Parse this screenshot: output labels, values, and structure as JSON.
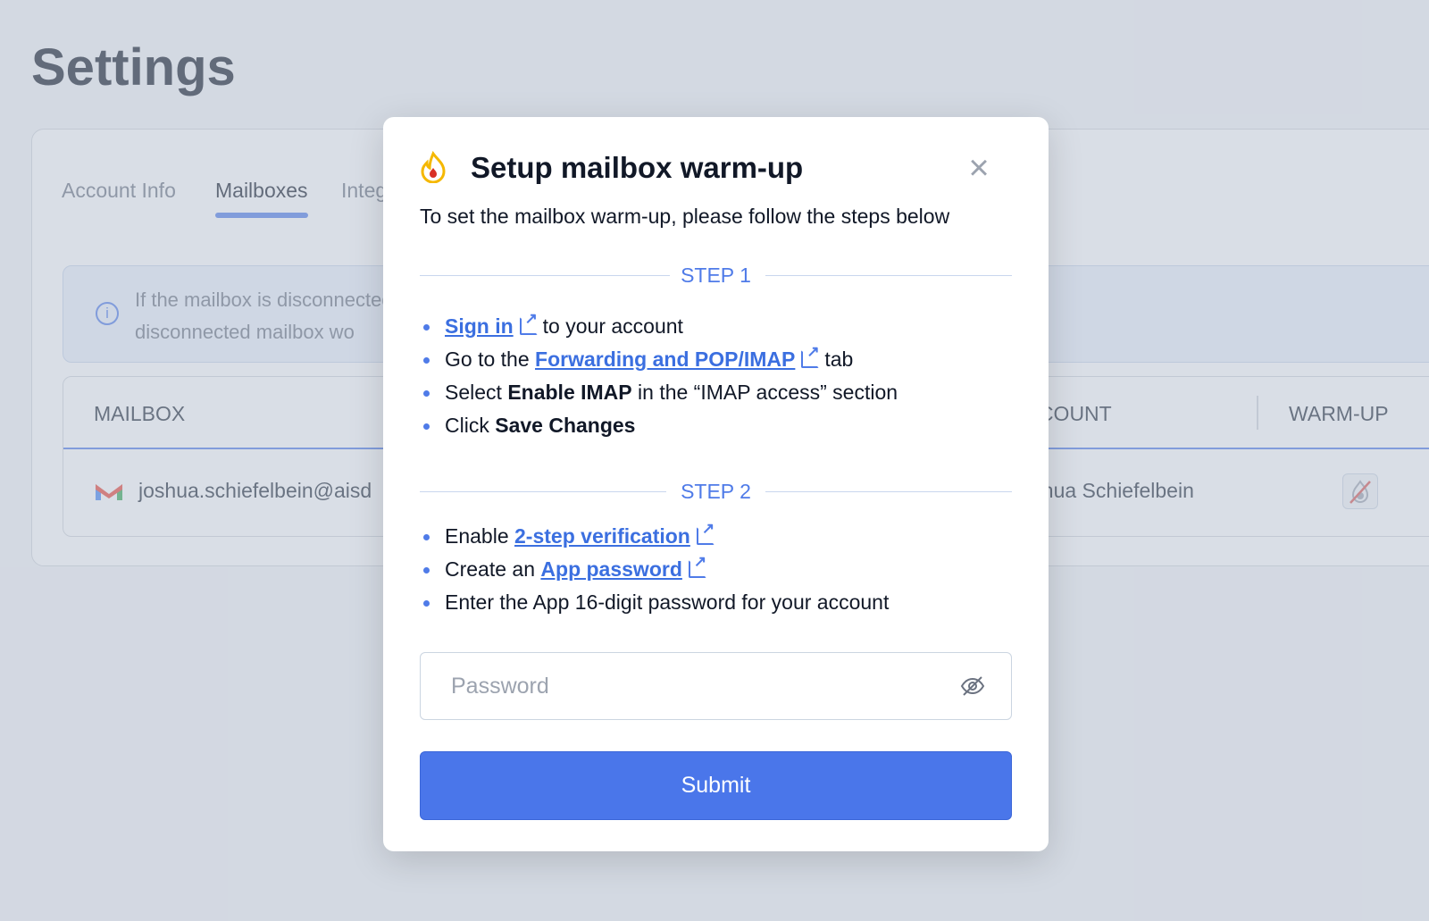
{
  "page": {
    "title": "Settings"
  },
  "tabs": [
    {
      "label": "Account Info"
    },
    {
      "label": "Mailboxes",
      "active": true
    },
    {
      "label": "Integ"
    }
  ],
  "info": {
    "line1": "If the mailbox is disconnected, the active campaign will come to a half. Additionally",
    "line2": "disconnected mailbox wo"
  },
  "table": {
    "headers": [
      "MAILBOX",
      "ACCOUNT",
      "WARM-UP"
    ],
    "rows": [
      {
        "mailbox": "joshua.schiefelbein@aisd",
        "account": "Joshua Schiefelbein",
        "warmup_icon": "warmup-disabled-icon"
      }
    ]
  },
  "modal": {
    "title": "Setup mailbox warm-up",
    "subtitle": "To set the mailbox warm-up, please follow the steps below",
    "step1": {
      "label": "STEP 1",
      "b1": {
        "link": "Sign in",
        "rest": "to your account"
      },
      "b2": {
        "pre": "Go to the",
        "link": "Forwarding and POP/IMAP",
        "rest": "tab"
      },
      "b3": {
        "pre": "Select",
        "bold": "Enable IMAP",
        "rest": "in the “IMAP access” section"
      },
      "b4": {
        "pre": "Click",
        "bold": "Save Changes"
      }
    },
    "step2": {
      "label": "STEP 2",
      "b1": {
        "pre": "Enable",
        "link": "2-step verification"
      },
      "b2": {
        "pre": "Create an",
        "link": "App password"
      },
      "b3": {
        "text": "Enter the App 16-digit password for your account"
      }
    },
    "password_placeholder": "Password",
    "submit_label": "Submit"
  },
  "colors": {
    "accent": "#4a76ea",
    "flame": "#f5b800"
  }
}
